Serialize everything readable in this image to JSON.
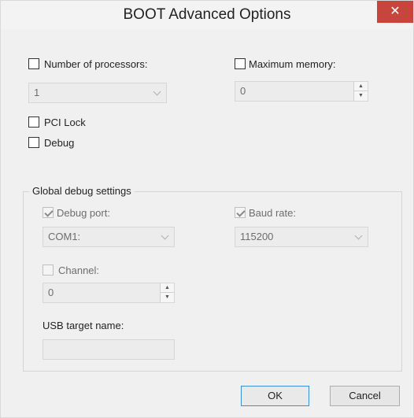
{
  "window": {
    "title": "BOOT Advanced Options",
    "close_glyph": "✕"
  },
  "processors": {
    "label": "Number of processors:",
    "value": "1",
    "checked": false
  },
  "memory": {
    "label": "Maximum memory:",
    "value": "0",
    "checked": false
  },
  "pci_lock": {
    "label": "PCI Lock",
    "checked": false
  },
  "debug": {
    "label": "Debug",
    "checked": false
  },
  "global_debug": {
    "group_title": "Global debug settings",
    "debug_port": {
      "label": "Debug port:",
      "value": "COM1:",
      "checked": true
    },
    "baud_rate": {
      "label": "Baud rate:",
      "value": "115200",
      "checked": true
    },
    "channel": {
      "label": "Channel:",
      "value": "0",
      "checked": false
    },
    "usb_target": {
      "label": "USB target name:",
      "value": ""
    }
  },
  "buttons": {
    "ok": "OK",
    "cancel": "Cancel"
  },
  "colors": {
    "close_button": "#c7453c",
    "default_button_border": "#3c8fd6",
    "background": "#f0f0f0"
  }
}
